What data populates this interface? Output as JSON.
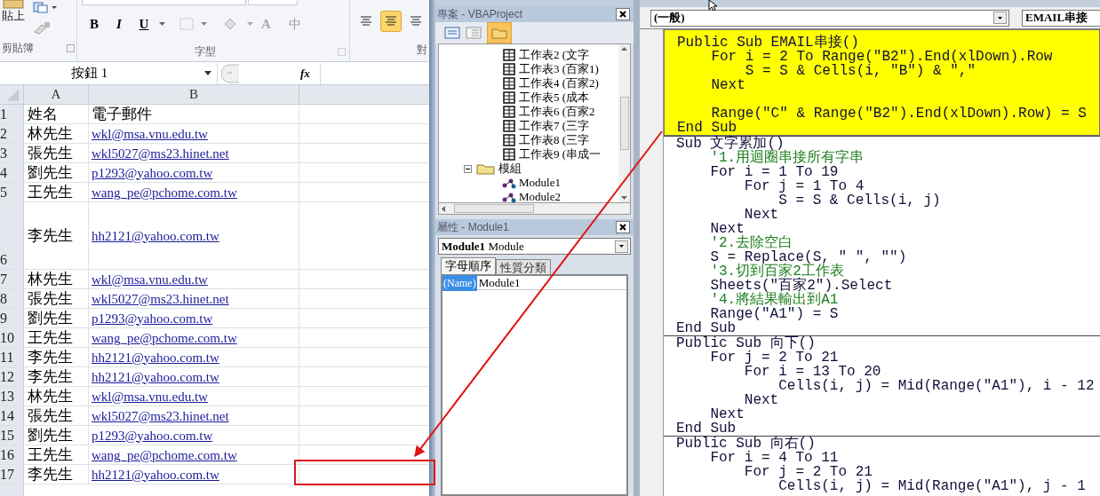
{
  "excel": {
    "ribbon": {
      "paste_label": "貼上",
      "groups": [
        {
          "label": "剪貼簿"
        },
        {
          "label": "字型"
        },
        {
          "label": "對"
        }
      ],
      "font_buttons": [
        {
          "kind": "bold",
          "label": "B"
        },
        {
          "kind": "italic",
          "label": "I"
        },
        {
          "kind": "underline",
          "label": "U"
        },
        {
          "kind": "border"
        },
        {
          "kind": "fill"
        },
        {
          "kind": "font-color",
          "label": "A"
        },
        {
          "kind": "phonetic",
          "label": "中"
        }
      ],
      "align_buttons": [
        {
          "selected": false
        },
        {
          "selected": true
        },
        {
          "selected": false
        }
      ]
    },
    "name_box": "按鈕 1",
    "fx": "fx",
    "columns": [
      "A",
      "B"
    ],
    "rows": [
      {
        "num": "1",
        "name": "姓名",
        "email": "電子郵件",
        "link": false,
        "tall": false
      },
      {
        "num": "2",
        "name": "林先生",
        "email": "wkl@msa.vnu.edu.tw",
        "link": true,
        "tall": false
      },
      {
        "num": "3",
        "name": "張先生",
        "email": "wkl5027@ms23.hinet.net",
        "link": true,
        "tall": false
      },
      {
        "num": "4",
        "name": "劉先生",
        "email": "p1293@yahoo.com.tw",
        "link": true,
        "tall": false
      },
      {
        "num": "5",
        "name": "王先生",
        "email": "wang_pe@pchome.com.tw",
        "link": true,
        "tall": false
      },
      {
        "num": "6",
        "name": "李先生",
        "email": "hh2121@yahoo.com.tw",
        "link": true,
        "tall": true
      },
      {
        "num": "7",
        "name": "林先生",
        "email": "wkl@msa.vnu.edu.tw",
        "link": true,
        "tall": false
      },
      {
        "num": "8",
        "name": "張先生",
        "email": "wkl5027@ms23.hinet.net",
        "link": true,
        "tall": false
      },
      {
        "num": "9",
        "name": "劉先生",
        "email": "p1293@yahoo.com.tw",
        "link": true,
        "tall": false
      },
      {
        "num": "10",
        "name": "王先生",
        "email": "wang_pe@pchome.com.tw",
        "link": true,
        "tall": false
      },
      {
        "num": "11",
        "name": "李先生",
        "email": "hh2121@yahoo.com.tw",
        "link": true,
        "tall": false
      },
      {
        "num": "12",
        "name": "李先生",
        "email": "hh2121@yahoo.com.tw",
        "link": true,
        "tall": false
      },
      {
        "num": "13",
        "name": "林先生",
        "email": "wkl@msa.vnu.edu.tw",
        "link": true,
        "tall": false
      },
      {
        "num": "14",
        "name": "張先生",
        "email": "wkl5027@ms23.hinet.net",
        "link": true,
        "tall": false
      },
      {
        "num": "15",
        "name": "劉先生",
        "email": "p1293@yahoo.com.tw",
        "link": true,
        "tall": false
      },
      {
        "num": "16",
        "name": "王先生",
        "email": "wang_pe@pchome.com.tw",
        "link": true,
        "tall": false
      },
      {
        "num": "17",
        "name": "李先生",
        "email": "hh2121@yahoo.com.tw",
        "link": true,
        "tall": false
      }
    ]
  },
  "vba": {
    "project": {
      "title": "專案 - VBAProject",
      "tree": [
        {
          "kind": "hidden-folder",
          "children": [
            {
              "kind": "sheet",
              "label": "工作表2 (文字"
            },
            {
              "kind": "sheet",
              "label": "工作表3 (百家1)"
            },
            {
              "kind": "sheet",
              "label": "工作表4 (百家2)"
            },
            {
              "kind": "sheet",
              "label": "工作表5 (成本"
            },
            {
              "kind": "sheet",
              "label": "工作表6 (百家2"
            },
            {
              "kind": "sheet",
              "label": "工作表7 (三字"
            },
            {
              "kind": "sheet",
              "label": "工作表8 (三字"
            },
            {
              "kind": "sheet",
              "label": "工作表9 (串成一"
            }
          ]
        },
        {
          "kind": "folder",
          "label": "模組",
          "expanded": true,
          "children": [
            {
              "kind": "module",
              "label": "Module1"
            },
            {
              "kind": "module",
              "label": "Module2"
            }
          ]
        }
      ]
    },
    "properties": {
      "title": "屬性 - Module1",
      "object": "**Module1** Module",
      "tabs": [
        {
          "label": "字母順序",
          "selected": true
        },
        {
          "label": "性質分類",
          "selected": false
        }
      ],
      "rows": [
        {
          "name": "(Name)",
          "value": "Module1",
          "selected": true
        }
      ]
    },
    "code": {
      "object": "(一般)",
      "procedure": "EMAIL串接",
      "procedures": [
        {
          "highlighted": true,
          "lines": [
            {
              "kind": "code",
              "text": "Public Sub EMAIL串接()"
            },
            {
              "kind": "code",
              "text": "    For i = 2 To Range(\"B2\").End(xlDown).Row"
            },
            {
              "kind": "code",
              "text": "        S = S & Cells(i, \"B\") & \",\""
            },
            {
              "kind": "code",
              "text": "    Next"
            },
            {
              "kind": "blank"
            },
            {
              "kind": "code",
              "text": "    Range(\"C\" & Range(\"B2\").End(xlDown).Row) = S"
            },
            {
              "kind": "code",
              "text": "End Sub"
            }
          ]
        },
        {
          "highlighted": false,
          "lines": [
            {
              "kind": "code",
              "text": "Sub 文字累加()"
            },
            {
              "kind": "comment",
              "text": "    '1.用迴圈串接所有字串"
            },
            {
              "kind": "code",
              "text": "    For i = 1 To 19"
            },
            {
              "kind": "code",
              "text": "        For j = 1 To 4"
            },
            {
              "kind": "code",
              "text": "            S = S & Cells(i, j)"
            },
            {
              "kind": "code",
              "text": "        Next"
            },
            {
              "kind": "code",
              "text": "    Next"
            },
            {
              "kind": "comment",
              "text": "    '2.去除空白"
            },
            {
              "kind": "code",
              "text": "    S = Replace(S, \" \", \"\")"
            },
            {
              "kind": "comment",
              "text": "    '3.切到百家2工作表"
            },
            {
              "kind": "code",
              "text": "    Sheets(\"百家2\").Select"
            },
            {
              "kind": "comment",
              "text": "    '4.將結果輸出到A1"
            },
            {
              "kind": "code",
              "text": "    Range(\"A1\") = S"
            },
            {
              "kind": "code",
              "text": "End Sub"
            }
          ]
        },
        {
          "highlighted": false,
          "lines": [
            {
              "kind": "code",
              "text": "Public Sub 向下()"
            },
            {
              "kind": "code",
              "text": "    For j = 2 To 21"
            },
            {
              "kind": "code",
              "text": "        For i = 13 To 20"
            },
            {
              "kind": "code",
              "text": "            Cells(i, j) = Mid(Range(\"A1\"), i - 12"
            },
            {
              "kind": "code",
              "text": "        Next"
            },
            {
              "kind": "code",
              "text": "    Next"
            },
            {
              "kind": "code",
              "text": "End Sub"
            }
          ]
        },
        {
          "highlighted": false,
          "lines": [
            {
              "kind": "code",
              "text": "Public Sub 向右()"
            },
            {
              "kind": "code",
              "text": "    For i = 4 To 11"
            },
            {
              "kind": "code",
              "text": "        For j = 2 To 21"
            },
            {
              "kind": "code",
              "text": "            Cells(i, j) = Mid(Range(\"A1\"), j - 1"
            }
          ]
        }
      ]
    }
  }
}
